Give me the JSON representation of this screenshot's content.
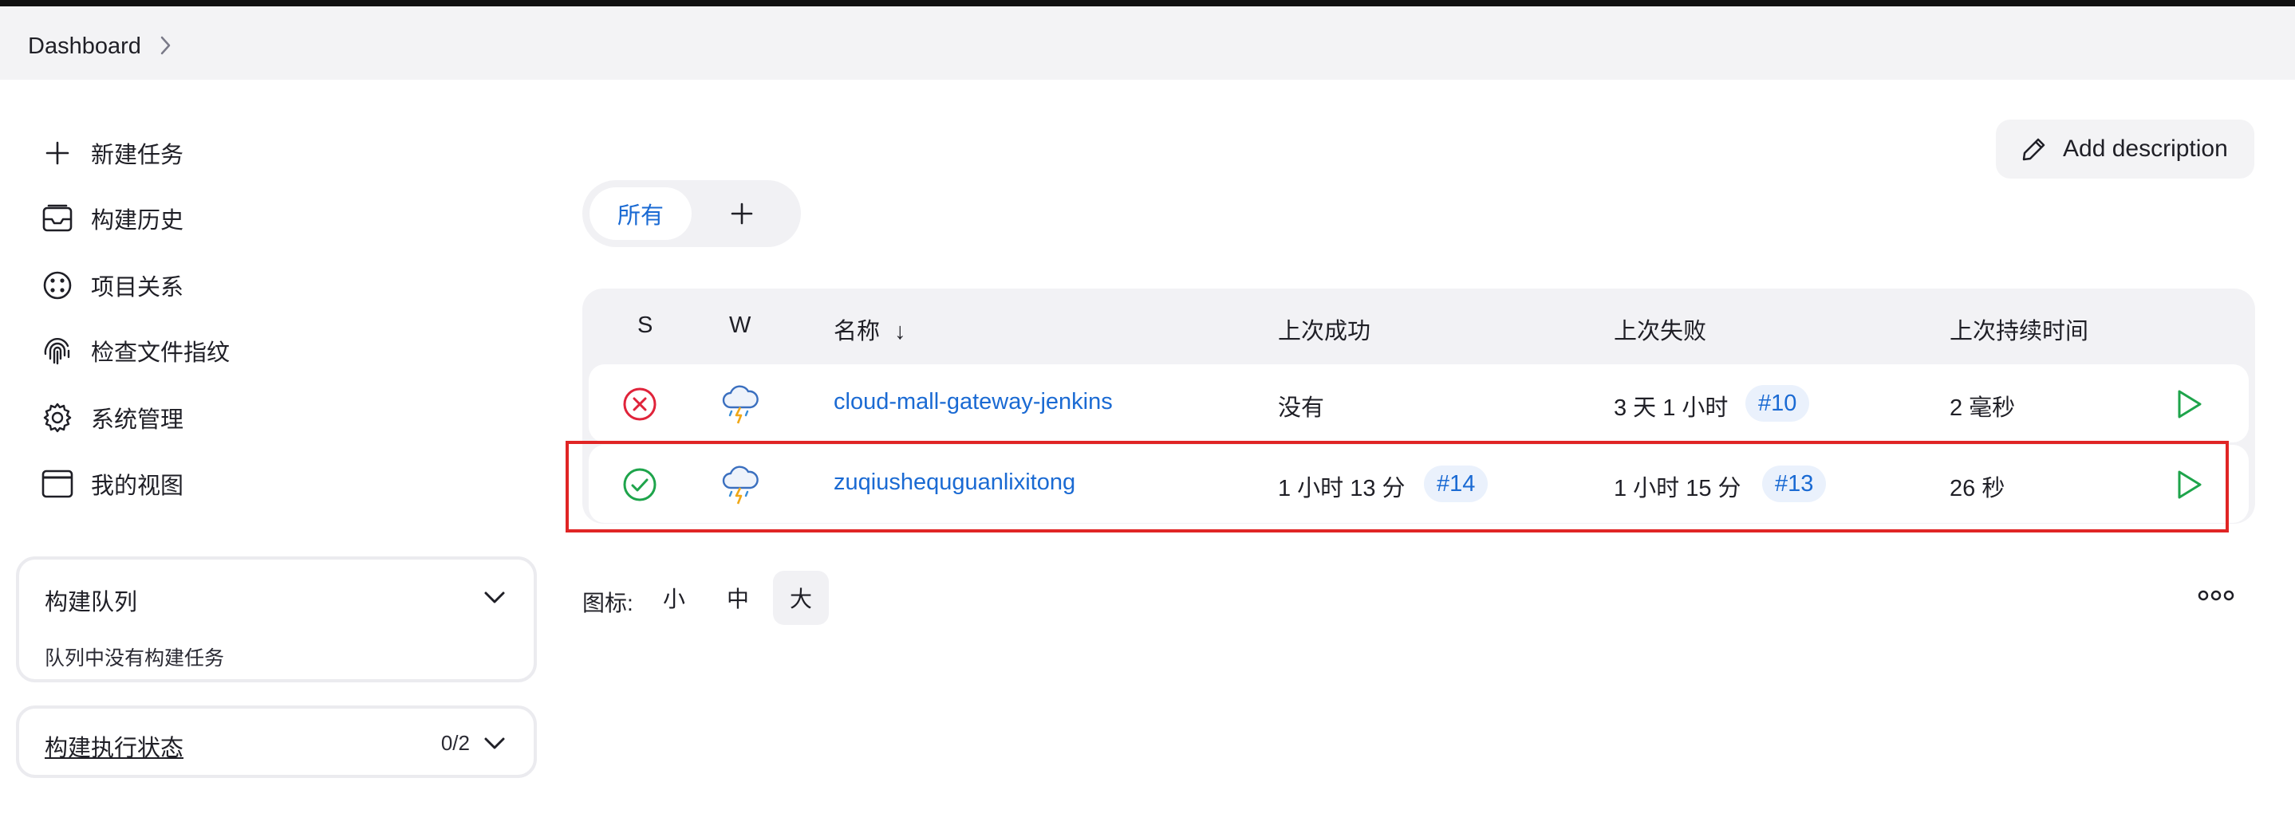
{
  "breadcrumb": {
    "items": [
      "Dashboard"
    ]
  },
  "sidebar": {
    "tasks": [
      {
        "label": "新建任务",
        "icon": "plus-icon"
      },
      {
        "label": "构建历史",
        "icon": "inbox-icon"
      },
      {
        "label": "项目关系",
        "icon": "relationship-icon"
      },
      {
        "label": "检查文件指纹",
        "icon": "fingerprint-icon"
      },
      {
        "label": "系统管理",
        "icon": "gear-icon"
      },
      {
        "label": "我的视图",
        "icon": "window-icon"
      }
    ],
    "build_queue": {
      "title": "构建队列",
      "empty_text": "队列中没有构建任务"
    },
    "executor_status": {
      "title": "构建执行状态",
      "count": "0/2"
    }
  },
  "main": {
    "add_description": "Add description",
    "tabs": [
      {
        "label": "所有"
      }
    ],
    "add_tab": "+",
    "table": {
      "headers": {
        "s": "S",
        "w": "W",
        "name": "名称",
        "sort_arrow": "↓",
        "last_success": "上次成功",
        "last_failure": "上次失败",
        "last_duration": "上次持续时间"
      },
      "rows": [
        {
          "status": "failed",
          "weather": "thunderstorm",
          "name": "cloud-mall-gateway-jenkins",
          "last_success": "没有",
          "last_success_build": "",
          "last_failure": "3 天 1 小时",
          "last_failure_build": "#10",
          "duration": "2 毫秒"
        },
        {
          "status": "success",
          "weather": "thunderstorm",
          "name": "zuqiushequguanlixitong",
          "last_success": "1 小时 13 分",
          "last_success_build": "#14",
          "last_failure": "1 小时 15 分",
          "last_failure_build": "#13",
          "duration": "26 秒"
        }
      ]
    },
    "icon_size": {
      "label": "图标:",
      "options": [
        "小",
        "中",
        "大"
      ],
      "selected": "大"
    }
  },
  "colors": {
    "accent": "#1a6ad3",
    "success": "#1ea44b",
    "failure": "#e0233a",
    "highlight": "#e02525"
  }
}
